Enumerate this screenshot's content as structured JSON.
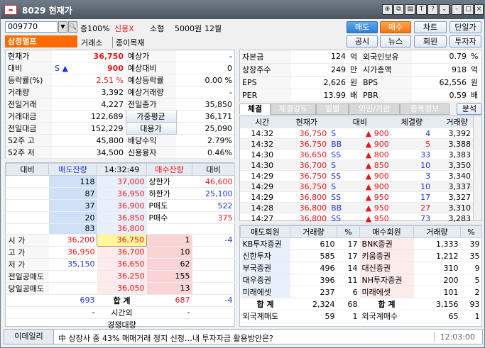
{
  "window": {
    "title": "8029 현재가"
  },
  "toolbar": {
    "code": "009770",
    "margin": "증100%",
    "credit": "신용X",
    "size": "소형",
    "face": "5000원",
    "month": "12월",
    "sell": "매도",
    "buy": "매수",
    "chart": "차트",
    "single": "단일가",
    "notice": "공시",
    "news": "뉴스",
    "member": "회원",
    "investor": "투자자"
  },
  "stock": {
    "name": "삼정펄프",
    "market": "거래소",
    "sector": "종이목재"
  },
  "summary": [
    {
      "k": "현재가",
      "v": "36,750",
      "k2": "예상가",
      "v2": "-"
    },
    {
      "k": "대비",
      "v": "900",
      "k2": "예상대비",
      "v2": "0"
    },
    {
      "k": "등락률(%)",
      "v": "2.51 %",
      "k2": "예상등락률",
      "v2": "0.00 %"
    },
    {
      "k": "거래량",
      "v": "3,392",
      "k2": "예상거래량",
      "v2": "-"
    },
    {
      "k": "전일거래",
      "v": "4,227",
      "k2": "전일종가",
      "v2": "35,850"
    },
    {
      "k": "거래대금",
      "v": "122,689",
      "k2": "가중평균",
      "v2": "36,171"
    },
    {
      "k": "전일대금",
      "v": "152,229",
      "k2": "대용가",
      "v2": "25,090"
    },
    {
      "k": "52주 고",
      "v": "45,800",
      "k2": "배당수익",
      "v2": "2.79%"
    },
    {
      "k": "52주 저",
      "v": "34,500",
      "k2": "신용융자",
      "v2": "0.46%"
    }
  ],
  "diff_sign": "S",
  "diff_arrow": "▲",
  "fundamentals": [
    {
      "k": "자본금",
      "v": "124",
      "u": "억",
      "k2": "외국인보유",
      "v2": "0.79",
      "u2": "%"
    },
    {
      "k": "상장주수",
      "v": "249",
      "u": "만",
      "k2": "시가총액",
      "v2": "918",
      "u2": "억"
    },
    {
      "k": "EPS",
      "v": "2,626",
      "u": "원",
      "k2": "BPS",
      "v2": "62,556",
      "u2": "원"
    },
    {
      "k": "PER",
      "v": "13.99",
      "u": "배",
      "k2": "PBR",
      "v2": "0.59",
      "u2": "배"
    }
  ],
  "tabs": [
    "체결",
    "체결강도",
    "일별",
    "외인/기관",
    "종목정보"
  ],
  "tab_action": "분석",
  "ticks_header": [
    "시간",
    "현재가",
    "대비",
    "체결량",
    "거래량"
  ],
  "ticks": [
    {
      "t": "14:32",
      "p": "36,750",
      "s": "S",
      "d": "900",
      "q": "4",
      "vol": "3,392"
    },
    {
      "t": "14:32",
      "p": "36,750",
      "s": "BB",
      "d": "900",
      "q": "5",
      "vol": "3,388"
    },
    {
      "t": "14:30",
      "p": "36,650",
      "s": "SS",
      "d": "800",
      "q": "33",
      "vol": "3,383"
    },
    {
      "t": "14:30",
      "p": "36,700",
      "s": "S",
      "d": "850",
      "q": "10",
      "vol": "3,350"
    },
    {
      "t": "14:29",
      "p": "36,750",
      "s": "SS",
      "d": "900",
      "q": "3",
      "vol": "3,340"
    },
    {
      "t": "14:29",
      "p": "36,750",
      "s": "S",
      "d": "900",
      "q": "10",
      "vol": "3,337"
    },
    {
      "t": "14:29",
      "p": "36,800",
      "s": "SS",
      "d": "950",
      "q": "17",
      "vol": "3,327"
    },
    {
      "t": "14:28",
      "p": "36,800",
      "s": "BB",
      "d": "950",
      "q": "27",
      "vol": "3,310"
    },
    {
      "t": "14:27",
      "p": "36,800",
      "s": "SS",
      "d": "950",
      "q": "73",
      "vol": "3,283"
    }
  ],
  "orderbook": {
    "header": [
      "대비",
      "매도잔량",
      "14:32:49",
      "매수잔량",
      "대비"
    ],
    "asks": [
      {
        "q": "118",
        "p": "37,000",
        "r": "상한가",
        "rv": "46,600"
      },
      {
        "q": "87",
        "p": "36,950",
        "r": "하한가",
        "rv": "25,100"
      },
      {
        "q": "37",
        "p": "36,900",
        "r": "P매도",
        "rv": "522"
      },
      {
        "q": "20",
        "p": "36,850",
        "r": "P매수",
        "rv": "375"
      },
      {
        "q": "83",
        "p": "36,800",
        "r": "",
        "rv": ""
      }
    ],
    "bids": [
      {
        "l": "시  가",
        "lv": "36,200",
        "p": "36,750",
        "q": "1",
        "d": "-4"
      },
      {
        "l": "고  가",
        "lv": "36,950",
        "p": "36,700",
        "q": "10",
        "d": ""
      },
      {
        "l": "저  가",
        "lv": "35,150",
        "p": "36,650",
        "q": "62",
        "d": ""
      },
      {
        "l": "전일공매도",
        "lv": "",
        "p": "36,250",
        "q": "155",
        "d": ""
      },
      {
        "l": "당일공매도",
        "lv": "",
        "p": "36,050",
        "q": "13",
        "d": ""
      }
    ],
    "total": {
      "ask": "693",
      "label": "합 계",
      "bid": "687",
      "d": "-4"
    },
    "after": {
      "ask": "-",
      "label": "시간외",
      "bid": "-"
    },
    "comp": {
      "label": "경쟁대량"
    }
  },
  "brokers_header": [
    "매도회원",
    "거래량",
    "%",
    "매수회원",
    "거래량",
    "%"
  ],
  "brokers": [
    {
      "s": "KB투자증권",
      "sq": "610",
      "sp": "17",
      "b": "BNK증권",
      "bq": "1,333",
      "bp": "39"
    },
    {
      "s": "신한투자",
      "sq": "585",
      "sp": "17",
      "b": "키움증권",
      "bq": "1,212",
      "bp": "35"
    },
    {
      "s": "부국증권",
      "sq": "496",
      "sp": "14",
      "b": "대신증권",
      "bq": "310",
      "bp": "9"
    },
    {
      "s": "대우증권",
      "sq": "396",
      "sp": "11",
      "b": "NH투자증권",
      "bq": "200",
      "bp": "5"
    },
    {
      "s": "미래에셋",
      "sq": "237",
      "sp": "6",
      "b": "미래에셋",
      "bq": "101",
      "bp": "2"
    }
  ],
  "broker_total": {
    "label": "합 계",
    "sq": "2,324",
    "sp": "68",
    "label2": "합 계",
    "bq": "3,156",
    "bp": "93"
  },
  "foreign": {
    "label": "외국계매도",
    "sq": "59",
    "sp": "1",
    "label2": "외국계매수",
    "bq": "65",
    "bp": "1"
  },
  "news": {
    "source": "이데일리",
    "headline": "中 상장사 중 43% 매매거래 정지 신청…내 투자자금 활용방안은?",
    "time": "12:03:00"
  },
  "colors": {
    "up": "#e8161b",
    "down": "#1e36d9",
    "accent": "#ff6a00"
  }
}
